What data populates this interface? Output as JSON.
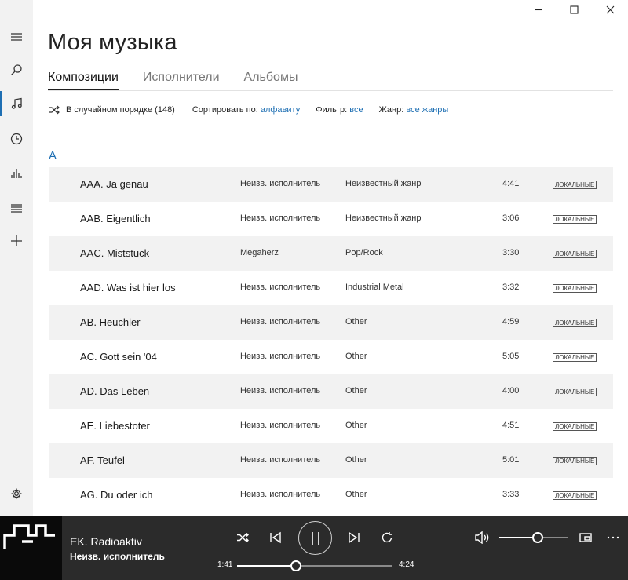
{
  "window": {
    "minimize_icon": "minimize-icon",
    "maximize_icon": "maximize-icon",
    "close_icon": "close-icon"
  },
  "nav": {
    "items": [
      {
        "icon": "hamburger-icon"
      },
      {
        "icon": "search-icon"
      },
      {
        "icon": "music-note-icon",
        "active": true
      },
      {
        "icon": "clock-icon"
      },
      {
        "icon": "equalizer-icon"
      },
      {
        "icon": "playlist-icon"
      },
      {
        "icon": "plus-icon"
      },
      {
        "icon": "gear-icon"
      }
    ]
  },
  "header": {
    "title": "Моя музыка",
    "tabs": [
      {
        "label": "Композиции",
        "active": true
      },
      {
        "label": "Исполнители",
        "active": false
      },
      {
        "label": "Альбомы",
        "active": false
      }
    ]
  },
  "toolbar": {
    "shuffle_label": "В случайном порядке (148)",
    "sort_label": "Сортировать по:",
    "sort_value": "алфавиту",
    "filter_label": "Фильтр:",
    "filter_value": "все",
    "genre_label": "Жанр:",
    "genre_value": "все жанры"
  },
  "list": {
    "group_letter": "A",
    "rows": [
      {
        "title": "AAA. Ja genau",
        "artist": "Неизв. исполнитель",
        "genre": "Неизвестный жанр",
        "duration": "4:41",
        "badge": "ЛОКАЛЬНЫЕ"
      },
      {
        "title": "AAB. Eigentlich",
        "artist": "Неизв. исполнитель",
        "genre": "Неизвестный жанр",
        "duration": "3:06",
        "badge": "ЛОКАЛЬНЫЕ"
      },
      {
        "title": "AAC. Miststuck",
        "artist": "Megaherz",
        "genre": "Pop/Rock",
        "duration": "3:30",
        "badge": "ЛОКАЛЬНЫЕ"
      },
      {
        "title": "AAD. Was ist hier los",
        "artist": "Неизв. исполнитель",
        "genre": "Industrial Metal",
        "duration": "3:32",
        "badge": "ЛОКАЛЬНЫЕ"
      },
      {
        "title": "AB. Heuchler",
        "artist": "Неизв. исполнитель",
        "genre": "Other",
        "duration": "4:59",
        "badge": "ЛОКАЛЬНЫЕ"
      },
      {
        "title": "AC. Gott sein '04",
        "artist": "Неизв. исполнитель",
        "genre": "Other",
        "duration": "5:05",
        "badge": "ЛОКАЛЬНЫЕ"
      },
      {
        "title": "AD. Das Leben",
        "artist": "Неизв. исполнитель",
        "genre": "Other",
        "duration": "4:00",
        "badge": "ЛОКАЛЬНЫЕ"
      },
      {
        "title": "AE. Liebestoter",
        "artist": "Неизв. исполнитель",
        "genre": "Other",
        "duration": "4:51",
        "badge": "ЛОКАЛЬНЫЕ"
      },
      {
        "title": "AF. Teufel",
        "artist": "Неизв. исполнитель",
        "genre": "Other",
        "duration": "5:01",
        "badge": "ЛОКАЛЬНЫЕ"
      },
      {
        "title": "AG. Du oder ich",
        "artist": "Неизв. исполнитель",
        "genre": "Other",
        "duration": "3:33",
        "badge": "ЛОКАЛЬНЫЕ"
      }
    ]
  },
  "player": {
    "track_title": "EK. Radioaktiv",
    "artist": "Неизв. исполнитель",
    "elapsed": "1:41",
    "total": "4:24",
    "progress_fraction": 0.38,
    "volume_fraction": 0.56,
    "accent_color": "#1e6fb3",
    "bar_color": "#2b2b2b"
  }
}
